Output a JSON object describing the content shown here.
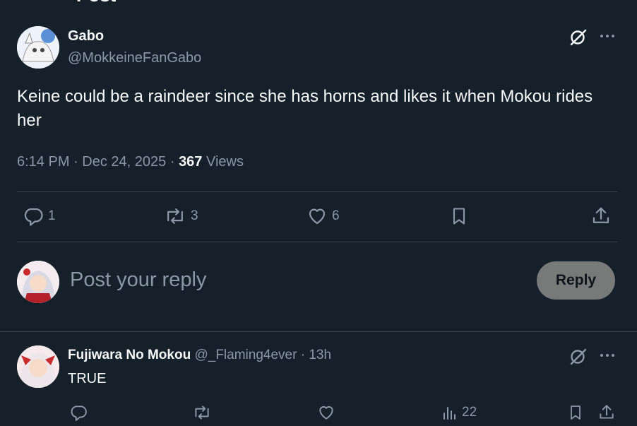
{
  "header": {
    "title": "Post"
  },
  "post": {
    "author_name": "Gabo",
    "author_handle": "@MokkeineFanGabo",
    "text": "Keine could be a raindeer since she has horns and likes it when Mokou rides her",
    "time": "6:14 PM",
    "separator": "·",
    "date": "Dec 24, 2025",
    "views_count": "367",
    "views_label": "Views",
    "actions": {
      "replies": "1",
      "reposts": "3",
      "likes": "6"
    }
  },
  "composer": {
    "placeholder": "Post your reply",
    "button_label": "Reply"
  },
  "reply": {
    "author_name": "Fujiwara No Mokou",
    "author_handle": "@_Flaming4ever",
    "separator": "·",
    "time_ago": "13h",
    "text": "TRUE",
    "views": "22"
  },
  "colors": {
    "background": "#15202b",
    "divider": "#38444d",
    "muted": "#8b98a5",
    "reply_button": "#787a7a"
  }
}
